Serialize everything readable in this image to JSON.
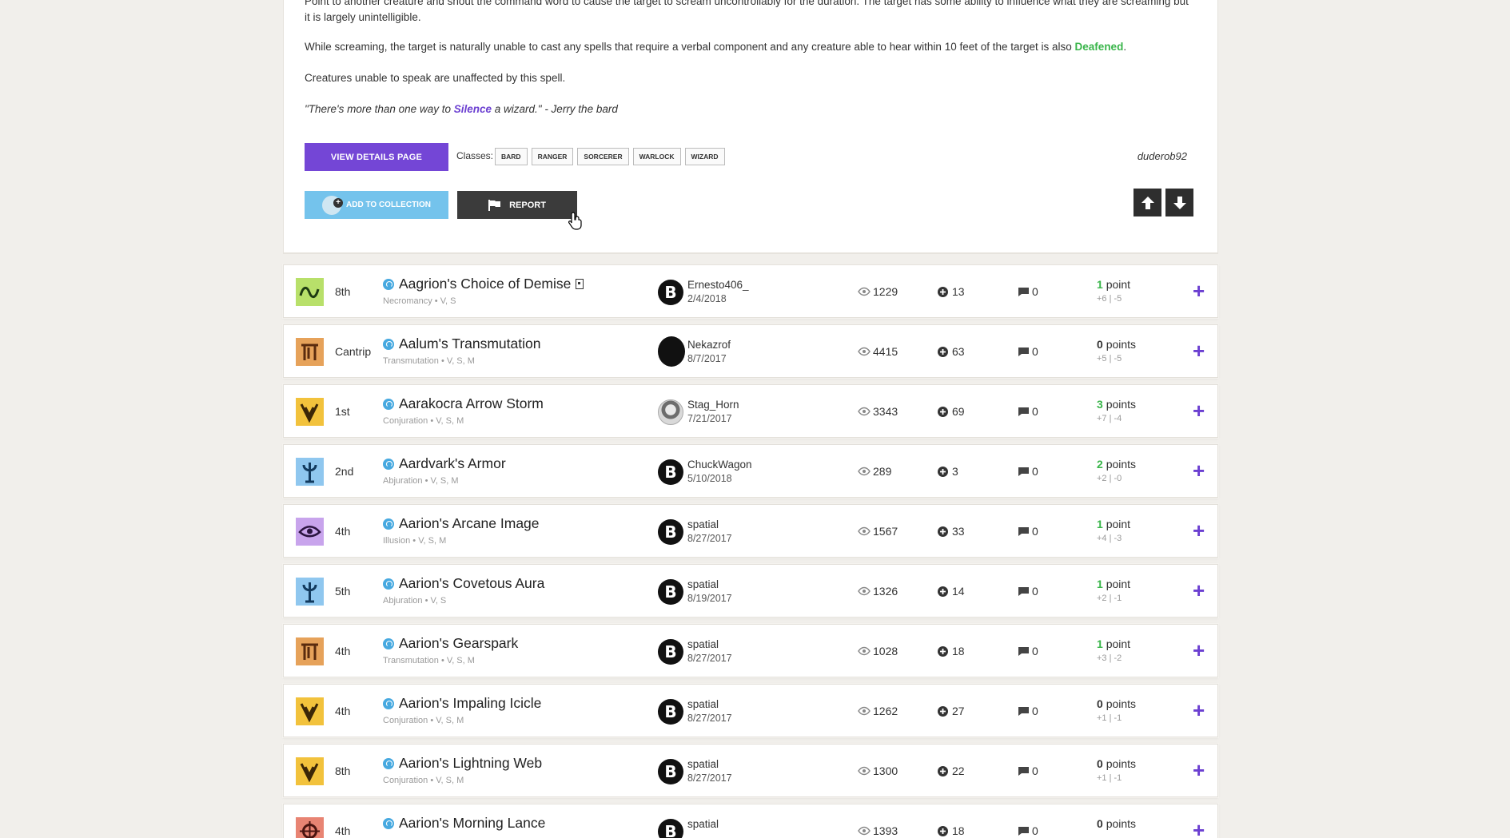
{
  "spell_detail": {
    "paragraphs": [
      "Point to another creature and shout the command word to cause the target to scream uncontrollably for the duration. The target has some ability to influence what they are screaming but it is largely unintelligible.",
      "Creatures unable to speak are unaffected by this spell."
    ],
    "p2_text": "While screaming, the target is naturally unable to cast any spells that require a verbal component and any creature able to hear within 10 feet of the target is also ",
    "p2_link": "Deafened",
    "p2_end": ".",
    "quote_start": "\"There's more than one way to ",
    "quote_link": "Silence",
    "quote_end": " a wizard.\" - Jerry the bard",
    "view_details_label": "View Details Page",
    "classes_label": "Classes:",
    "classes": [
      "BARD",
      "RANGER",
      "SORCERER",
      "WARLOCK",
      "WIZARD"
    ],
    "author": "duderob92",
    "add_to_collection_label": "Add to Collection",
    "report_label": "Report"
  },
  "spells": [
    {
      "name": "Aagrion's Choice of Demise",
      "level": "8th",
      "school": "Necromancy",
      "components": "V, S",
      "user": "Ernesto406_",
      "date": "2/4/2018",
      "views": "1229",
      "adds": "13",
      "comments": "0",
      "points": "1",
      "points_label": "point",
      "up": "+6",
      "down": "-5",
      "icon": "necromancy-icon",
      "avatar": "B",
      "book": true
    },
    {
      "name": "Aalum's Transmutation",
      "level": "Cantrip",
      "school": "Transmutation",
      "components": "V, S, M",
      "user": "Nekazrof",
      "date": "8/7/2017",
      "views": "4415",
      "adds": "63",
      "comments": "0",
      "points": "0",
      "points_label": "points",
      "up": "+5",
      "down": "-5",
      "icon": "transmutation-icon",
      "avatar": ""
    },
    {
      "name": "Aarakocra Arrow Storm",
      "level": "1st",
      "school": "Conjuration",
      "components": "V, S, M",
      "user": "Stag_Horn",
      "date": "7/21/2017",
      "views": "3343",
      "adds": "69",
      "comments": "0",
      "points": "3",
      "points_label": "points",
      "up": "+7",
      "down": "-4",
      "icon": "conjuration-icon",
      "avatar": ""
    },
    {
      "name": "Aardvark's Armor",
      "level": "2nd",
      "school": "Abjuration",
      "components": "V, S, M",
      "user": "ChuckWagon",
      "date": "5/10/2018",
      "views": "289",
      "adds": "3",
      "comments": "0",
      "points": "2",
      "points_label": "points",
      "up": "+2",
      "down": "-0",
      "icon": "abjuration-icon",
      "avatar": "B"
    },
    {
      "name": "Aarion's Arcane Image",
      "level": "4th",
      "school": "Illusion",
      "components": "V, S, M",
      "user": "spatial",
      "date": "8/27/2017",
      "views": "1567",
      "adds": "33",
      "comments": "0",
      "points": "1",
      "points_label": "point",
      "up": "+4",
      "down": "-3",
      "icon": "illusion-icon",
      "avatar": "B"
    },
    {
      "name": "Aarion's Covetous Aura",
      "level": "5th",
      "school": "Abjuration",
      "components": "V, S",
      "user": "spatial",
      "date": "8/19/2017",
      "views": "1326",
      "adds": "14",
      "comments": "0",
      "points": "1",
      "points_label": "point",
      "up": "+2",
      "down": "-1",
      "icon": "abjuration-icon",
      "avatar": "B"
    },
    {
      "name": "Aarion's Gearspark",
      "level": "4th",
      "school": "Transmutation",
      "components": "V, S, M",
      "user": "spatial",
      "date": "8/27/2017",
      "views": "1028",
      "adds": "18",
      "comments": "0",
      "points": "1",
      "points_label": "point",
      "up": "+3",
      "down": "-2",
      "icon": "transmutation-icon",
      "avatar": "B"
    },
    {
      "name": "Aarion's Impaling Icicle",
      "level": "4th",
      "school": "Conjuration",
      "components": "V, S, M",
      "user": "spatial",
      "date": "8/27/2017",
      "views": "1262",
      "adds": "27",
      "comments": "0",
      "points": "0",
      "points_label": "points",
      "up": "+1",
      "down": "-1",
      "icon": "conjuration-icon",
      "avatar": "B"
    },
    {
      "name": "Aarion's Lightning Web",
      "level": "8th",
      "school": "Conjuration",
      "components": "V, S, M",
      "user": "spatial",
      "date": "8/27/2017",
      "views": "1300",
      "adds": "22",
      "comments": "0",
      "points": "0",
      "points_label": "points",
      "up": "+1",
      "down": "-1",
      "icon": "conjuration-icon",
      "avatar": "B"
    },
    {
      "name": "Aarion's Morning Lance",
      "level": "4th",
      "school": "",
      "components": "",
      "user": "spatial",
      "date": "",
      "views": "1393",
      "adds": "18",
      "comments": "0",
      "points": "0",
      "points_label": "points",
      "up": "",
      "down": "",
      "icon": "evocation-icon",
      "avatar": "B"
    }
  ],
  "colors": {
    "accent_purple": "#7446d6",
    "collection_blue": "#74c3ec",
    "points_green": "#39b54a",
    "report_dark": "#3b3b3b"
  }
}
